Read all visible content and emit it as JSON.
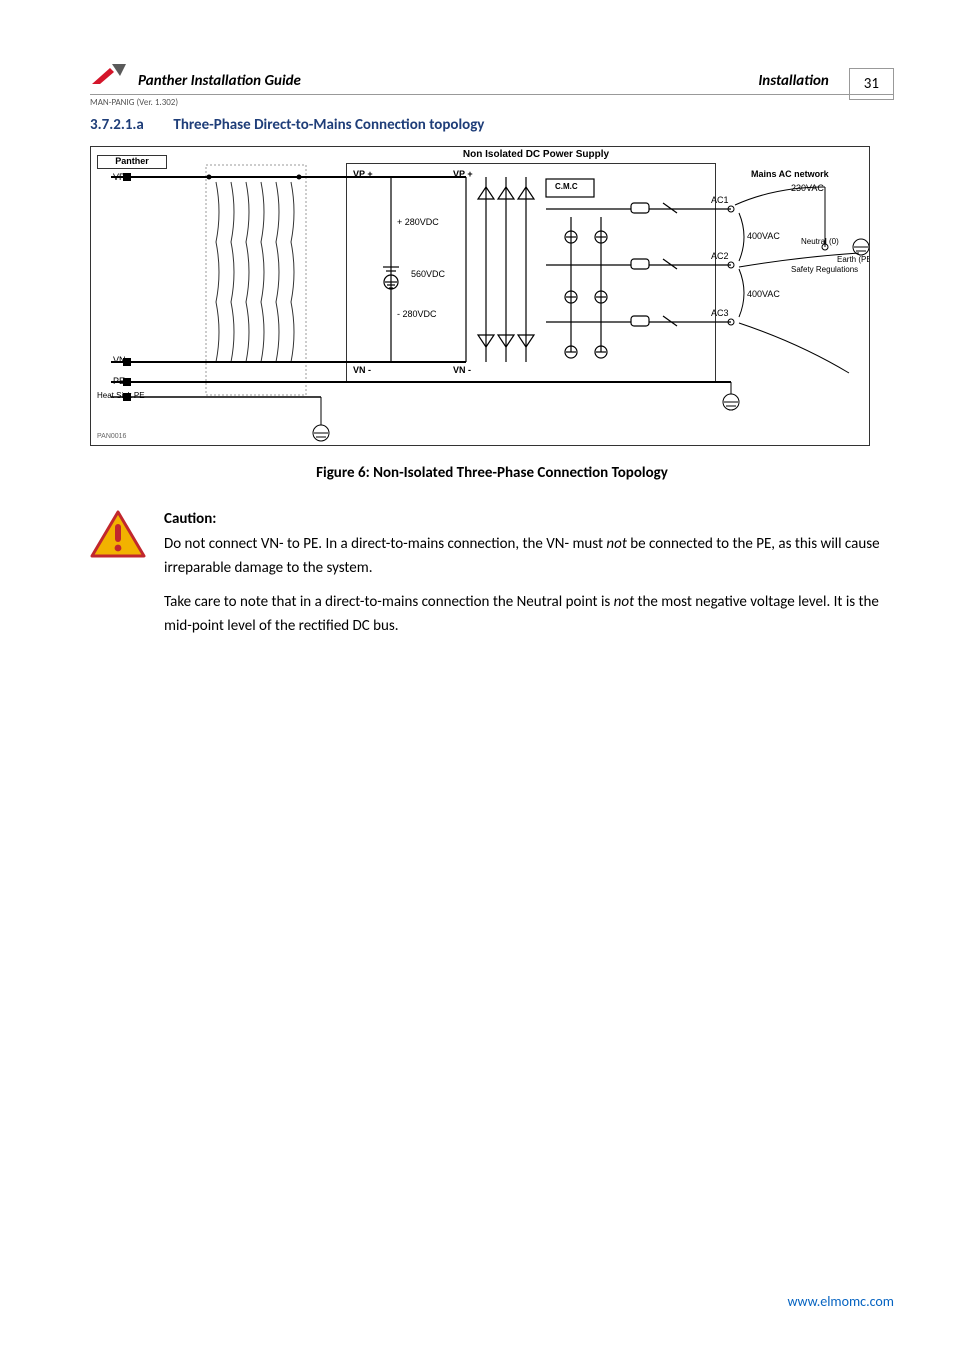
{
  "header": {
    "title": "Panther Installation Guide",
    "section": "Installation",
    "page_number": "31",
    "version_line": "MAN-PANIG (Ver. 1.302)"
  },
  "section": {
    "number": "3.7.2.1.a",
    "title": "Three-Phase Direct-to-Mains Connection topology"
  },
  "diagram": {
    "panther_box": "Panther",
    "ps_title": "Non Isolated DC Power Supply",
    "vp_plus_left": "VP +",
    "vp_plus_mid": "VP +",
    "vp_plus_right": "VP +",
    "vn_minus_left": "VN -",
    "vn_minus_mid": "VN -",
    "vn_minus_right": "VN -",
    "plus280": "+ 280VDC",
    "dc560": "560VDC",
    "minus280": "- 280VDC",
    "pe": "PE",
    "hs_pe": "Heat Sink PE",
    "cmc": "C.M.C",
    "mains_title": "Mains AC network",
    "v230": "230VAC",
    "v400a": "400VAC",
    "v400b": "400VAC",
    "ac1": "AC1",
    "ac2": "AC2",
    "ac3": "AC3",
    "neutral": "Neutral (0)",
    "earth": "Earth (PE)",
    "safety": "Safety Regulations",
    "figid": "PAN0016"
  },
  "figure_caption": "Figure 6: Non-Isolated Three-Phase Connection Topology",
  "caution": {
    "head": "Caution:",
    "p1a": "Do not connect VN- to PE. In a direct-to-mains connection, the VN- must ",
    "p1_em": "not",
    "p1b": " be connected to the PE, as this will cause irreparable damage to the system.",
    "p2a": "Take care to note that in a direct-to-mains connection the Neutral point is ",
    "p2_em": "not",
    "p2b": " the most negative voltage level. It is the mid-point level of the rectified DC bus."
  },
  "footer": {
    "url": "www.elmomc.com"
  }
}
